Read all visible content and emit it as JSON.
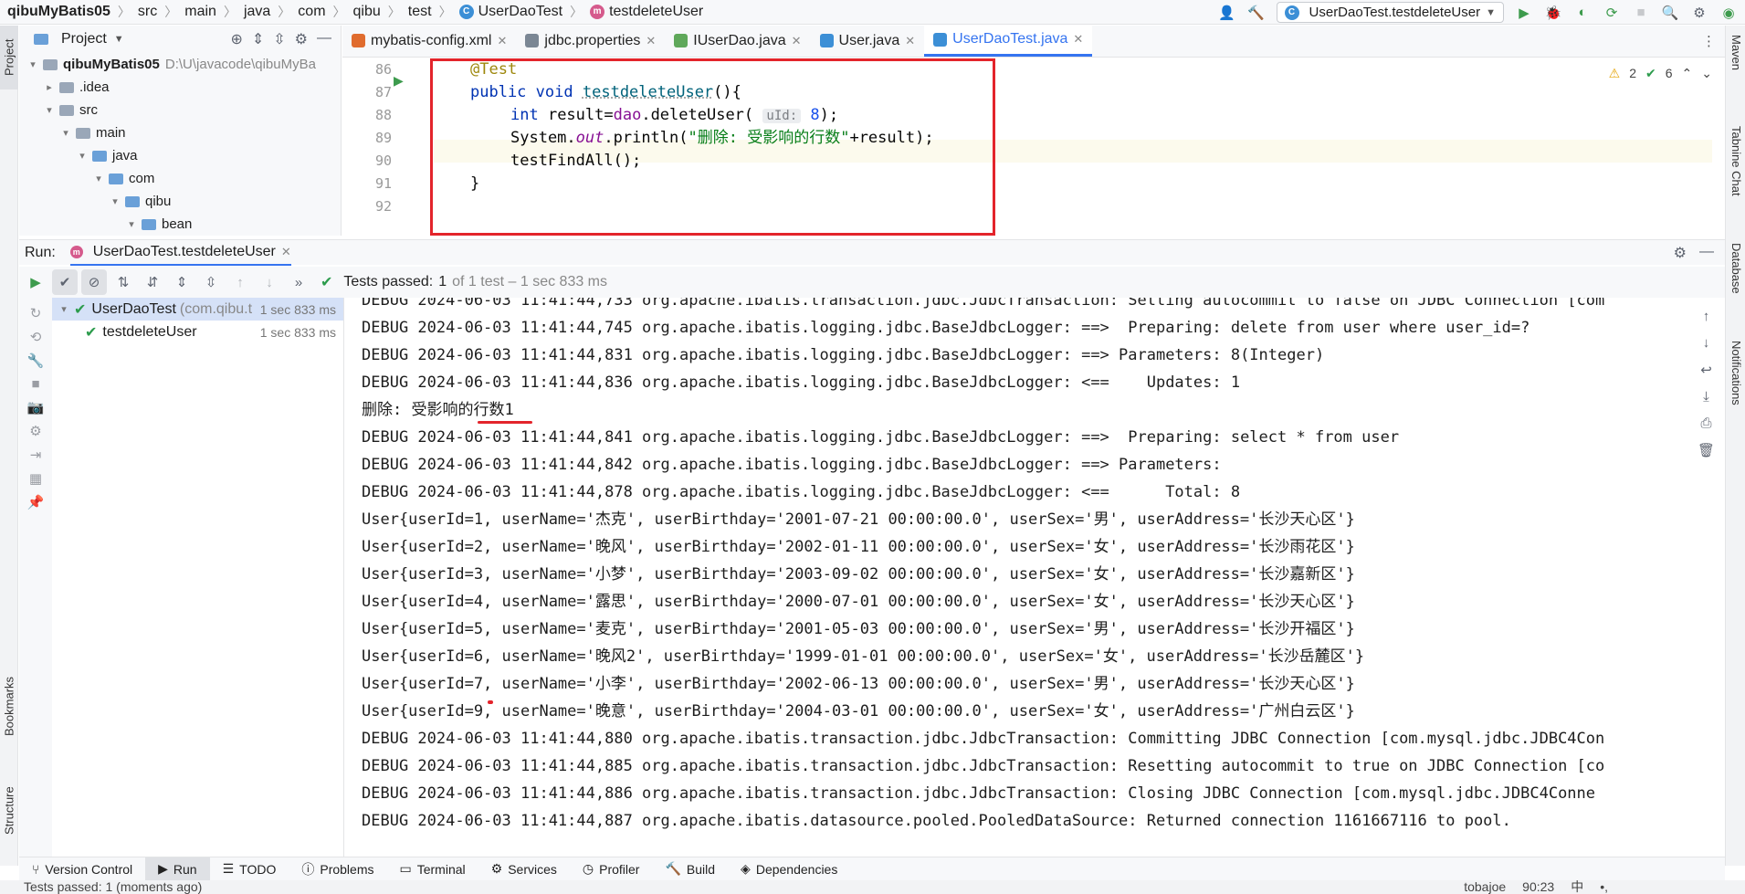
{
  "breadcrumb": [
    "qibuMyBatis05",
    "src",
    "main",
    "java",
    "com",
    "qibu",
    "test",
    "UserDaoTest",
    "testdeleteUser"
  ],
  "run_config": "UserDaoTest.testdeleteUser",
  "project_panel": {
    "title": "Project",
    "tree": [
      {
        "label": "qibuMyBatis05",
        "hint": "D:\\U\\javacode\\qibuMyBa",
        "depth": 0,
        "open": true
      },
      {
        "label": ".idea",
        "depth": 1,
        "open": false
      },
      {
        "label": "src",
        "depth": 1,
        "open": true
      },
      {
        "label": "main",
        "depth": 2,
        "open": true
      },
      {
        "label": "java",
        "depth": 3,
        "open": true
      },
      {
        "label": "com",
        "depth": 4,
        "open": true
      },
      {
        "label": "qibu",
        "depth": 5,
        "open": true
      },
      {
        "label": "bean",
        "depth": 6,
        "open": true
      }
    ]
  },
  "editor_tabs": [
    {
      "label": "mybatis-config.xml",
      "color": "#e06c2e",
      "active": false
    },
    {
      "label": "jdbc.properties",
      "color": "#7b8794",
      "active": false
    },
    {
      "label": "IUserDao.java",
      "color": "#5fa85a",
      "active": false
    },
    {
      "label": "User.java",
      "color": "#3c8fd6",
      "active": false
    },
    {
      "label": "UserDaoTest.java",
      "color": "#3c8fd6",
      "active": true
    }
  ],
  "editor": {
    "line_numbers": [
      "86",
      "87",
      "88",
      "89",
      "90",
      "91",
      "92"
    ],
    "warnings": "2",
    "checks": "6",
    "code": {
      "l86_annotation": "@Test",
      "l87_public": "public",
      "l87_void": "void",
      "l87_name": "testdeleteUser",
      "l87_rest": "(){",
      "l88_int": "int",
      "l88_pre": " result=",
      "l88_dao": "dao",
      "l88_call": ".deleteUser(",
      "l88_hint": "uId:",
      "l88_num": "8",
      "l88_end": ");",
      "l89_sys": "System.",
      "l89_out": "out",
      "l89_call": ".println(",
      "l89_str": "\"删除: 受影响的行数\"",
      "l89_end": "+result);",
      "l90": "testFindAll();",
      "l91": "}"
    }
  },
  "run_panel": {
    "label": "Run:",
    "tab": "UserDaoTest.testdeleteUser",
    "tests_passed": "Tests passed:",
    "passed_count": "1",
    "passed_detail": "of 1 test – 1 sec 833 ms",
    "tree": [
      {
        "label": "UserDaoTest",
        "sub": "(com.qibu.t",
        "duration": "1 sec 833 ms"
      },
      {
        "label": "testdeleteUser",
        "sub": "",
        "duration": "1 sec 833 ms"
      }
    ],
    "console": [
      "DEBUG 2024-06-03 11:41:44,733 org.apache.ibatis.transaction.jdbc.JdbcTransaction: Setting autocommit to false on JDBC Connection [com",
      "DEBUG 2024-06-03 11:41:44,745 org.apache.ibatis.logging.jdbc.BaseJdbcLogger: ==>  Preparing: delete from user where user_id=?",
      "DEBUG 2024-06-03 11:41:44,831 org.apache.ibatis.logging.jdbc.BaseJdbcLogger: ==> Parameters: 8(Integer)",
      "DEBUG 2024-06-03 11:41:44,836 org.apache.ibatis.logging.jdbc.BaseJdbcLogger: <==    Updates: 1",
      "删除: 受影响的行数1",
      "DEBUG 2024-06-03 11:41:44,841 org.apache.ibatis.logging.jdbc.BaseJdbcLogger: ==>  Preparing: select * from user",
      "DEBUG 2024-06-03 11:41:44,842 org.apache.ibatis.logging.jdbc.BaseJdbcLogger: ==> Parameters: ",
      "DEBUG 2024-06-03 11:41:44,878 org.apache.ibatis.logging.jdbc.BaseJdbcLogger: <==      Total: 8",
      "User{userId=1, userName='杰克', userBirthday='2001-07-21 00:00:00.0', userSex='男', userAddress='长沙天心区'}",
      "User{userId=2, userName='晚风', userBirthday='2002-01-11 00:00:00.0', userSex='女', userAddress='长沙雨花区'}",
      "User{userId=3, userName='小梦', userBirthday='2003-09-02 00:00:00.0', userSex='女', userAddress='长沙嘉新区'}",
      "User{userId=4, userName='露思', userBirthday='2000-07-01 00:00:00.0', userSex='女', userAddress='长沙天心区'}",
      "User{userId=5, userName='麦克', userBirthday='2001-05-03 00:00:00.0', userSex='男', userAddress='长沙开福区'}",
      "User{userId=6, userName='晚风2', userBirthday='1999-01-01 00:00:00.0', userSex='女', userAddress='长沙岳麓区'}",
      "User{userId=7, userName='小李', userBirthday='2002-06-13 00:00:00.0', userSex='男', userAddress='长沙天心区'}",
      "User{userId=9, userName='晚意', userBirthday='2004-03-01 00:00:00.0', userSex='女', userAddress='广州白云区'}",
      "DEBUG 2024-06-03 11:41:44,880 org.apache.ibatis.transaction.jdbc.JdbcTransaction: Committing JDBC Connection [com.mysql.jdbc.JDBC4Con",
      "DEBUG 2024-06-03 11:41:44,885 org.apache.ibatis.transaction.jdbc.JdbcTransaction: Resetting autocommit to true on JDBC Connection [co",
      "DEBUG 2024-06-03 11:41:44,886 org.apache.ibatis.transaction.jdbc.JdbcTransaction: Closing JDBC Connection [com.mysql.jdbc.JDBC4Conne",
      "DEBUG 2024-06-03 11:41:44,887 org.apache.ibatis.datasource.pooled.PooledDataSource: Returned connection 1161667116 to pool."
    ]
  },
  "bottom_tabs": [
    "Version Control",
    "Run",
    "TODO",
    "Problems",
    "Terminal",
    "Services",
    "Profiler",
    "Build",
    "Dependencies"
  ],
  "left_stripe": [
    "Project",
    "Bookmarks",
    "Structure"
  ],
  "right_stripe": [
    "Maven",
    "Tabnine Chat",
    "Database",
    "Notifications"
  ],
  "status": {
    "message": "Tests passed: 1 (moments ago)",
    "user": "tobajoe",
    "position": "90:23",
    "ime": [
      "中",
      "•,"
    ]
  },
  "colors": {
    "accent": "#3574f0",
    "highlight_box": "#e3242b",
    "pass_green": "#2d9c4d"
  }
}
